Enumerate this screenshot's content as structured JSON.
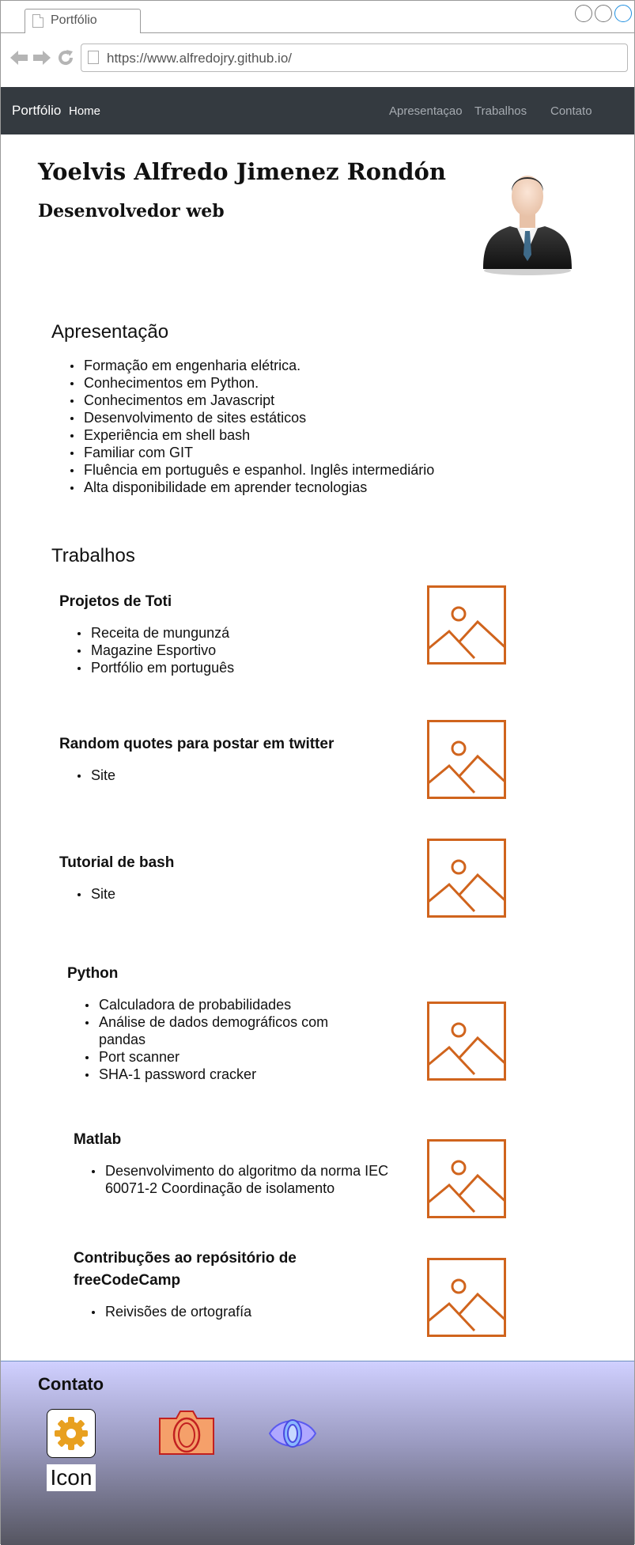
{
  "browser": {
    "tab_title": "Portfólio",
    "url": "https://www.alfredojry.github.io/"
  },
  "navbar": {
    "brand": "Portfólio",
    "home": "Home",
    "links": [
      "Apresentaçao",
      "Trabalhos",
      "Contato"
    ]
  },
  "header": {
    "name": "Yoelvis Alfredo Jimenez Rondón",
    "role": "Desenvolvedor web"
  },
  "apresentacao": {
    "title": "Apresentação",
    "items": [
      "Formação em engenharia elétrica.",
      "Conhecimentos em Python.",
      "Conhecimentos em Javascript",
      "Desenvolvimento de sites estáticos",
      "Experiência em shell bash",
      "Familiar com GIT",
      "Fluência em português e espanhol. Inglês intermediário",
      "Alta disponibilidade em aprender tecnologias"
    ]
  },
  "trabalhos": {
    "title": "Trabalhos",
    "projects": [
      {
        "title": "Projetos de Toti",
        "items": [
          "Receita de mungunzá",
          "Magazine Esportivo",
          "Portfólio em português"
        ]
      },
      {
        "title": "Random quotes para postar em twitter",
        "items": [
          "Site"
        ]
      },
      {
        "title": "Tutorial de bash",
        "items": [
          "Site"
        ]
      },
      {
        "title": "Python",
        "items": [
          "Calculadora de probabilidades",
          "Análise de dados demográficos com pandas",
          "Port scanner",
          "SHA-1 password cracker"
        ]
      },
      {
        "title": "Matlab",
        "items": [
          "Desenvolvimento do algoritmo da norma IEC 60071-2 Coordinação de isolamento"
        ]
      },
      {
        "title": "Contribuções ao repósitório de freeCodeCamp",
        "items": [
          "Reivisões de ortografía"
        ]
      }
    ]
  },
  "contato": {
    "title": "Contato",
    "icon_label": "Icon",
    "icons": [
      "gear-icon",
      "camera-icon",
      "eye-icon"
    ]
  },
  "colors": {
    "navbar": "#343a40",
    "placeholder_stroke": "#d0641d",
    "contact_gradient_top": "#d0d0ff",
    "contact_gradient_bottom": "#555560"
  }
}
